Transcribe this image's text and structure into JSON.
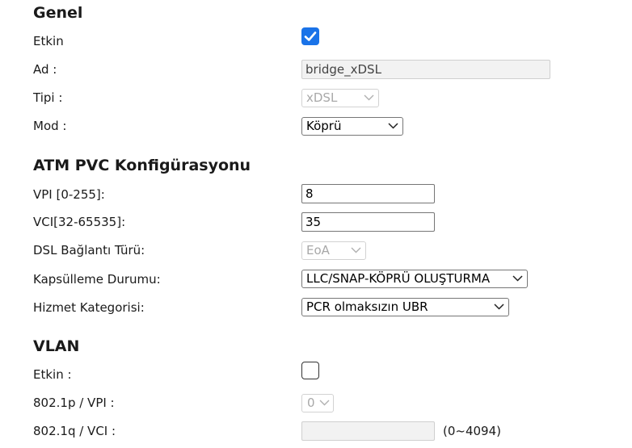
{
  "genel": {
    "title": "Genel",
    "enabled_label": "Etkin",
    "enabled": true,
    "name_label": "Ad :",
    "name_value": "bridge_xDSL",
    "type_label": "Tipi :",
    "type_value": "xDSL",
    "mode_label": "Mod :",
    "mode_value": "Köprü"
  },
  "atm": {
    "title": "ATM PVC Konfigürasyonu",
    "vpi_label": "VPI [0-255]:",
    "vpi_value": "8",
    "vci_label": "VCI[32-65535]:",
    "vci_value": "35",
    "dsl_type_label": "DSL Bağlantı Türü:",
    "dsl_type_value": "EoA",
    "encap_label": "Kapsülleme Durumu:",
    "encap_value": "LLC/SNAP-KÖPRÜ OLUŞTURMA",
    "service_label": "Hizmet Kategorisi:",
    "service_value": "PCR olmaksızın UBR"
  },
  "vlan": {
    "title": "VLAN",
    "enabled_label": "Etkin :",
    "enabled": false,
    "p_label": "802.1p / VPI :",
    "p_value": "0",
    "q_label": "802.1q / VCI :",
    "q_value": "",
    "q_hint": "(0~4094)"
  },
  "colors": {
    "checkbox_checked": "#1a73e8"
  }
}
